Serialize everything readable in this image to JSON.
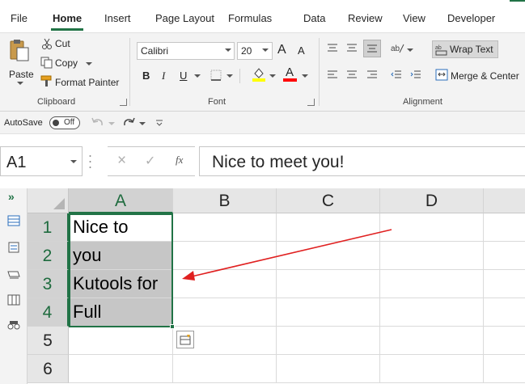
{
  "menu": {
    "tabs": [
      "File",
      "Home",
      "Insert",
      "Page Layout",
      "Formulas",
      "Data",
      "Review",
      "View",
      "Developer"
    ],
    "active": "Home"
  },
  "clipboard": {
    "paste": "Paste",
    "cut": "Cut",
    "copy": "Copy",
    "format_painter": "Format Painter",
    "label": "Clipboard"
  },
  "font": {
    "name": "Calibri",
    "size": "20",
    "bold": "B",
    "italic": "I",
    "underline": "U",
    "grow": "A",
    "shrink": "A",
    "label": "Font",
    "highlight_color": "#ffff00",
    "font_color": "#ff0000"
  },
  "alignment": {
    "wrap_text": "Wrap Text",
    "merge_center": "Merge & Center",
    "label": "Alignment"
  },
  "qat": {
    "autosave": "AutoSave",
    "autosave_state": "Off"
  },
  "formula_bar": {
    "name_box": "A1",
    "cancel_icon": "×",
    "enter_icon": "✓",
    "fx": "fx",
    "content": "Nice to meet you!"
  },
  "sheet": {
    "columns": [
      "A",
      "B",
      "C",
      "D"
    ],
    "rows": [
      "1",
      "2",
      "3",
      "4",
      "5",
      "6"
    ],
    "cells": {
      "A1": "Nice to",
      "A2": "you",
      "A3": "Kutools for",
      "A4": "Full"
    }
  },
  "colors": {
    "accent": "#217346",
    "arrow": "#e02020"
  }
}
